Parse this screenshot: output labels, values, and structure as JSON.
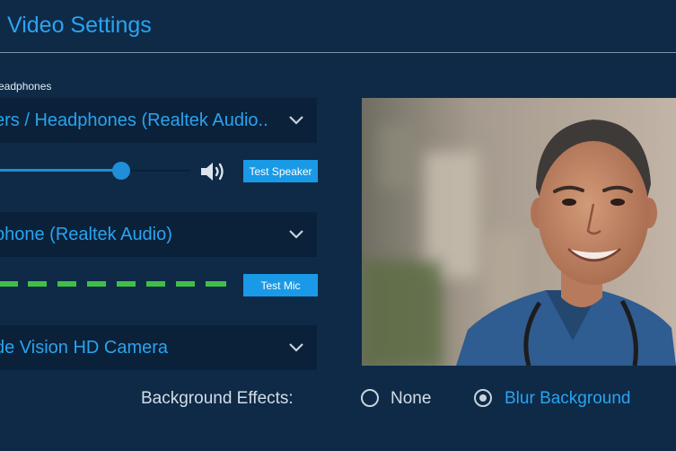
{
  "header": {
    "title": "Video Settings"
  },
  "speakers": {
    "section_label": "eadphones",
    "dropdown_value": "ers / Headphones (Realtek Audio..",
    "volume_level": 0.62,
    "test_button": "Test Speaker"
  },
  "microphone": {
    "dropdown_value": "phone (Realtek Audio)",
    "test_button": "Test Mic"
  },
  "camera": {
    "dropdown_value": "de Vision HD Camera"
  },
  "background_effects": {
    "label": "Background Effects:",
    "options": [
      {
        "label": "None",
        "selected": false
      },
      {
        "label": "Blur Background",
        "selected": true
      }
    ]
  },
  "colors": {
    "accent": "#2aa3f0",
    "button": "#1a9ae6",
    "panel": "#0e2a47",
    "field": "#0a2139",
    "mic_level": "#3fbf4a"
  },
  "icons": [
    "chevron-down-icon",
    "speaker-volume-icon",
    "radio-icon"
  ]
}
